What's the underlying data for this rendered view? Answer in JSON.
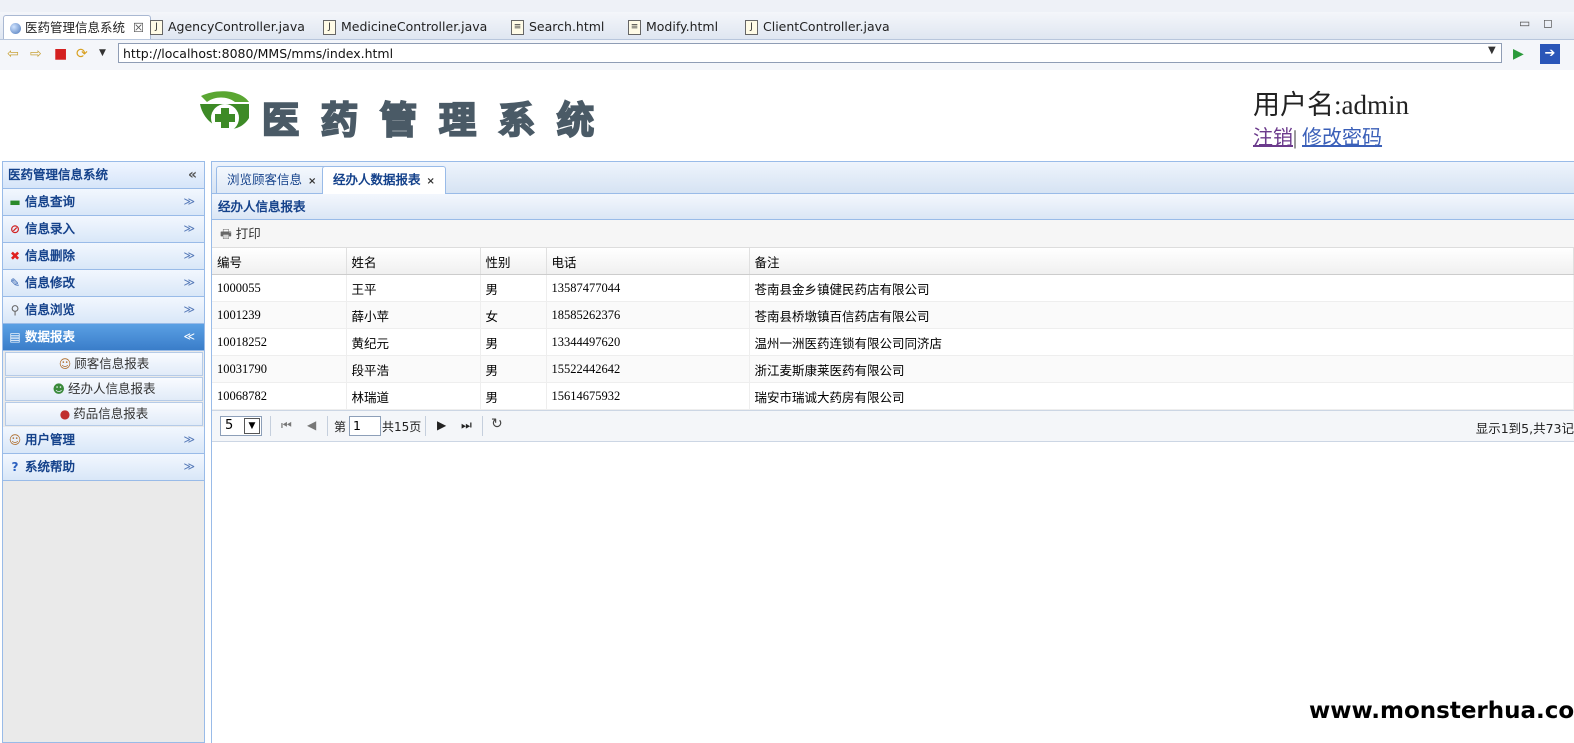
{
  "ide": {
    "editor_tabs": [
      {
        "label": "医药管理信息系统",
        "icon": "globe-icon",
        "active": true,
        "close": "☒"
      },
      {
        "label": "AgencyController.java",
        "icon": "java-file-icon"
      },
      {
        "label": "MedicineController.java",
        "icon": "java-file-icon"
      },
      {
        "label": "Search.html",
        "icon": "html-file-icon"
      },
      {
        "label": "Modify.html",
        "icon": "html-file-icon"
      },
      {
        "label": "ClientController.java",
        "icon": "java-file-icon"
      }
    ]
  },
  "browser": {
    "url": "http://localhost:8080/MMS/mms/index.html"
  },
  "header": {
    "logo_text": "医药管理系统",
    "username": "用户名:admin",
    "logout": "注销",
    "separator": "|",
    "change_password": "修改密码"
  },
  "sidebar": {
    "title": "医药管理信息系统",
    "collapse": "«",
    "sections": [
      {
        "label": "信息查询",
        "icon": "query-icon",
        "chevron": "≫"
      },
      {
        "label": "信息录入",
        "icon": "entry-icon",
        "chevron": "≫"
      },
      {
        "label": "信息删除",
        "icon": "delete-icon",
        "chevron": "≫"
      },
      {
        "label": "信息修改",
        "icon": "edit-icon",
        "chevron": "≫"
      },
      {
        "label": "信息浏览",
        "icon": "browse-icon",
        "chevron": "≫"
      },
      {
        "label": "数据报表",
        "icon": "report-icon",
        "chevron": "≪"
      },
      {
        "label": "用户管理",
        "icon": "user-icon",
        "chevron": "≫"
      },
      {
        "label": "系统帮助",
        "icon": "help-icon",
        "chevron": "≫"
      }
    ],
    "report_items": [
      {
        "label": "顾客信息报表",
        "icon": "customer-icon"
      },
      {
        "label": "经办人信息报表",
        "icon": "agent-icon"
      },
      {
        "label": "药品信息报表",
        "icon": "medicine-icon"
      }
    ]
  },
  "main": {
    "tabs": [
      {
        "label": "浏览顾客信息",
        "close": "×"
      },
      {
        "label": "经办人数据报表",
        "close": "×",
        "active": true
      }
    ],
    "panel_title": "经办人信息报表",
    "print_label": "打印",
    "columns": [
      "编号",
      "姓名",
      "性别",
      "电话",
      "备注"
    ],
    "rows": [
      [
        "1000055",
        "王平",
        "男",
        "13587477044",
        "苍南县金乡镇健民药店有限公司"
      ],
      [
        "1001239",
        "薛小苹",
        "女",
        "18585262376",
        "苍南县桥墩镇百信药店有限公司"
      ],
      [
        "10018252",
        "黄纪元",
        "男",
        "13344497620",
        "温州一洲医药连锁有限公司同济店"
      ],
      [
        "10031790",
        "段平浩",
        "男",
        "15522442642",
        "浙江麦斯康莱医药有限公司"
      ],
      [
        "10068782",
        "林瑞道",
        "男",
        "15614675932",
        "瑞安市瑞诚大药房有限公司"
      ]
    ],
    "pager": {
      "page_size": "5",
      "page_prefix": "第",
      "page_value": "1",
      "page_total": "共15页",
      "info": "显示1到5,共73记"
    }
  },
  "watermark": "www.monsterhua.com"
}
